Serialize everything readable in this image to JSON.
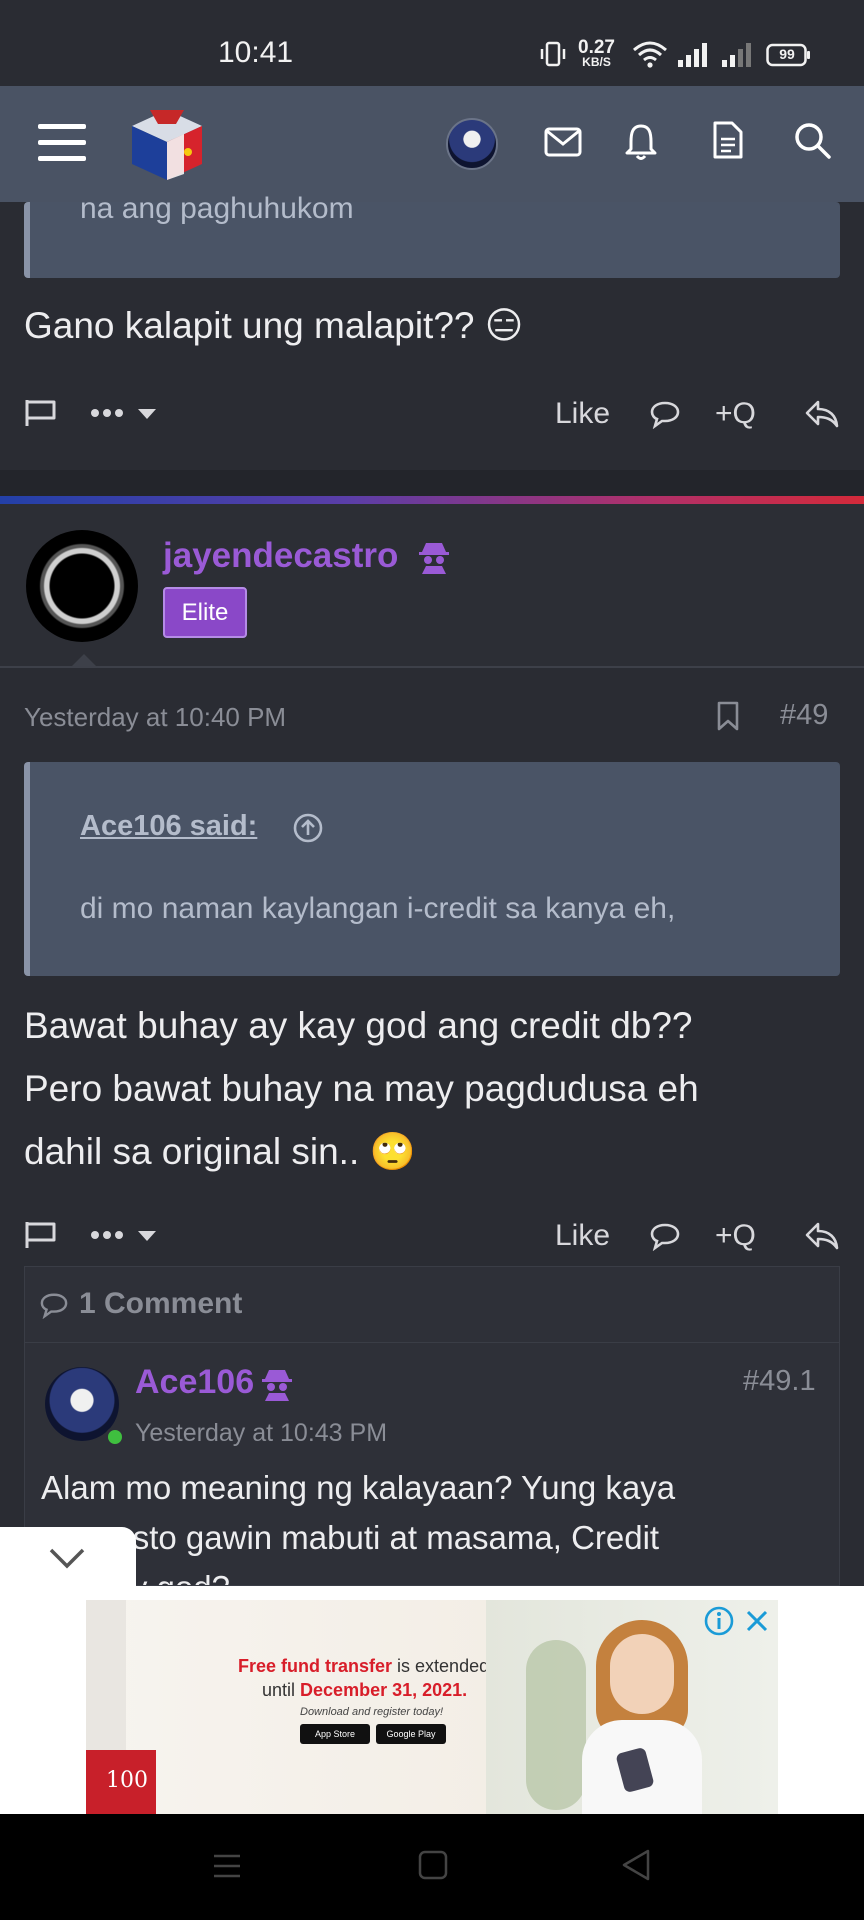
{
  "status_bar": {
    "time": "10:41",
    "net_speed_value": "0.27",
    "net_speed_unit": "KB/S",
    "battery": "99",
    "icons": [
      "vibrate-icon",
      "wifi-icon",
      "signal-icon",
      "signal-icon-2",
      "battery-icon"
    ]
  },
  "app_bar": {
    "icons": [
      "menu-icon",
      "logo",
      "avatar",
      "mail-icon",
      "bell-icon",
      "document-icon",
      "search-icon"
    ]
  },
  "prev_post": {
    "quote_tail": "na ang paghuhukom",
    "body": "Gano kalapit ung malapit?? 😑",
    "actions": {
      "like": "Like",
      "quote": "+Q"
    }
  },
  "post": {
    "author": "jayendecastro",
    "badge": "Elite",
    "time": "Yesterday at 10:40 PM",
    "number": "#49",
    "quote_author": "Ace106 said:",
    "quote_text": "di mo naman kaylangan i-credit sa kanya eh,",
    "body_lines": [
      "Bawat buhay ay kay god ang credit db??",
      "Pero bawat buhay na may pagdudusa eh",
      "dahil sa original sin.. 🙄"
    ],
    "actions": {
      "like": "Like",
      "quote": "+Q"
    }
  },
  "comments": {
    "header": "1 Comment",
    "item": {
      "author": "Ace106",
      "number": "#49.1",
      "time": "Yesterday at 10:43 PM",
      "text_line1": "Alam mo meaning ng kalayaan? Yung kaya",
      "text_line2": "mo gusto gawin mabuti at masama, Credit",
      "text_line3": "mo kay god?"
    }
  },
  "ad": {
    "line1_red": "Free fund transfer",
    "line1_rest": " is extended",
    "line2_prefix": "until ",
    "line2_red": "December 31, 2021.",
    "line3": "Download and register today!",
    "store1": "App Store",
    "store2": "Google Play",
    "badge": "100"
  },
  "colors": {
    "accent_purple": "#9a5ad6",
    "app_bar": "#4a5364",
    "background": "#2a2c33",
    "ad_red": "#d81e2a"
  }
}
